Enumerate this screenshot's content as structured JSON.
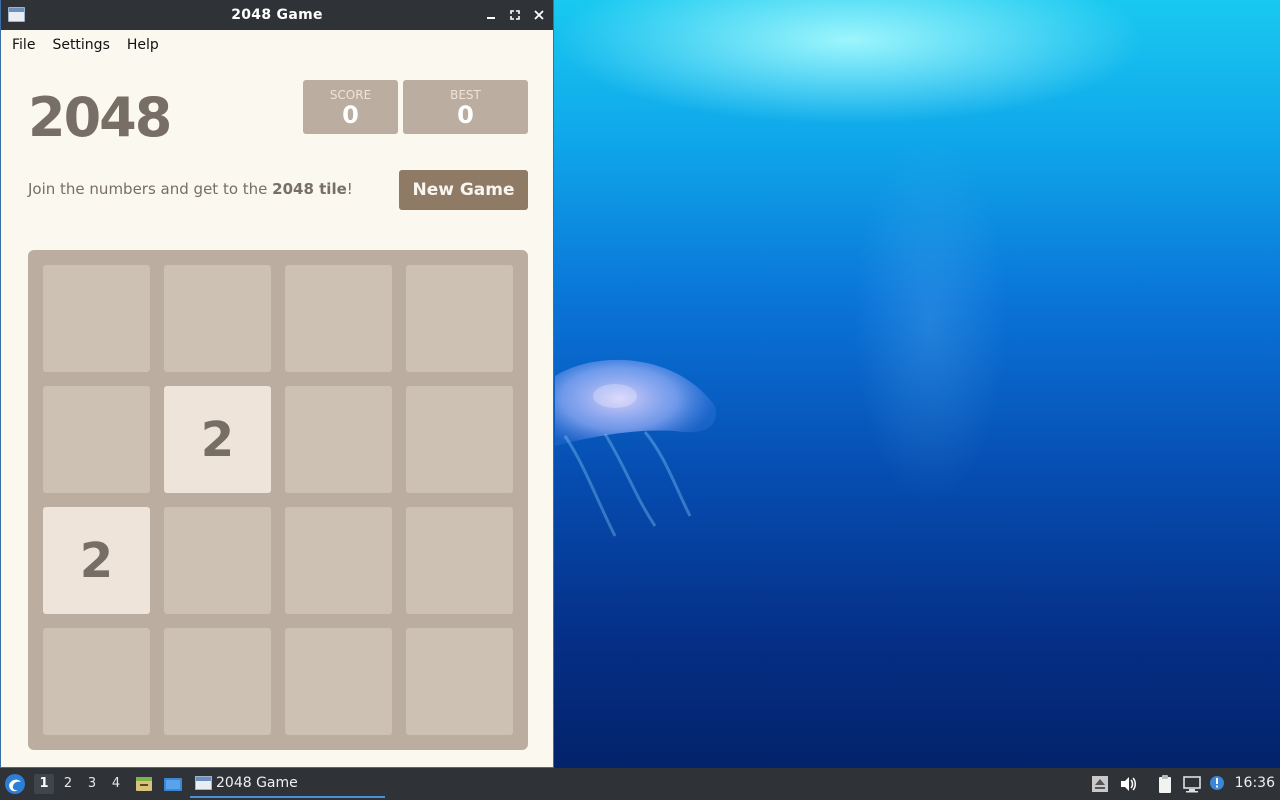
{
  "window": {
    "title": "2048 Game",
    "menu": [
      "File",
      "Settings",
      "Help"
    ]
  },
  "game": {
    "heading": "2048",
    "score_label": "SCORE",
    "score_value": "0",
    "best_label": "BEST",
    "best_value": "0",
    "intro_prefix": "Join the numbers and get to the ",
    "intro_bold": "2048 tile",
    "intro_suffix": "!",
    "new_game_label": "New Game",
    "board": [
      [
        "",
        "",
        "",
        ""
      ],
      [
        "",
        "2",
        "",
        ""
      ],
      [
        "2",
        "",
        "",
        ""
      ],
      [
        "",
        "",
        "",
        ""
      ]
    ]
  },
  "taskbar": {
    "workspaces": [
      "1",
      "2",
      "3",
      "4"
    ],
    "active_workspace": "1",
    "task_label": "2048 Game",
    "clock": "16:36"
  },
  "colors": {
    "board_bg": "#bbada0",
    "empty_cell": "#cdc1b4",
    "tile_2": "#eee4da",
    "text": "#776e65",
    "button": "#8f7a66"
  }
}
